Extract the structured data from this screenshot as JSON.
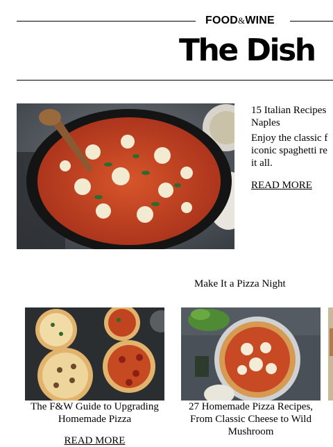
{
  "header": {
    "brand_left": "FOOD",
    "brand_amp": "&",
    "brand_right": "WINE",
    "title": "The Dish"
  },
  "feature": {
    "title_line1": "15 Italian Recipes",
    "title_line2": "Naples",
    "desc_line1": "Enjoy the classic f",
    "desc_line2": "iconic spaghetti re",
    "desc_line3": "it all.",
    "link": "READ MORE"
  },
  "section": {
    "title": "Make It a Pizza Night"
  },
  "cards": [
    {
      "title_line1": "The F&W Guide to Upgrading",
      "title_line2": "Homemade Pizza",
      "link": "READ MORE"
    },
    {
      "title_line1": "27 Homemade Pizza Recipes,",
      "title_line2": "From Classic Cheese to Wild",
      "title_line3": "Mushroom"
    }
  ]
}
